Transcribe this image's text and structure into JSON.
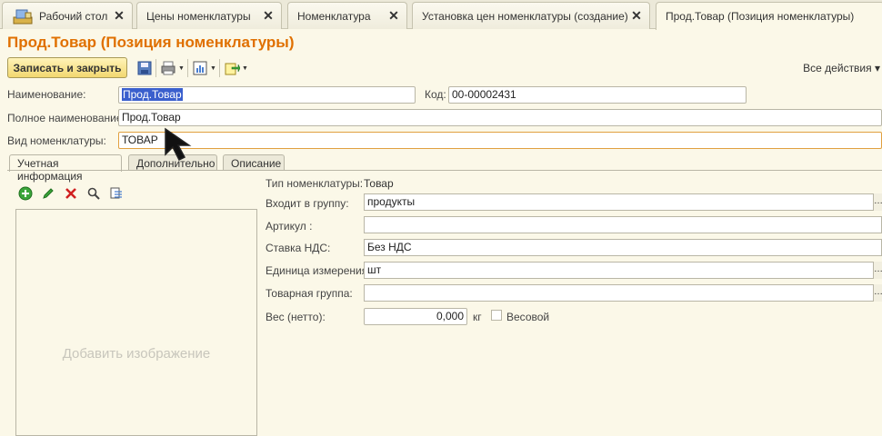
{
  "tabs": [
    {
      "label": "Рабочий стол",
      "home": true
    },
    {
      "label": "Цены номенклатуры"
    },
    {
      "label": "Номенклатура"
    },
    {
      "label": "Установка цен номенклатуры (создание) *"
    },
    {
      "label": "Прод.Товар (Позиция номенклатуры)",
      "active": true
    }
  ],
  "page_title": "Прод.Товар (Позиция номенклатуры)",
  "toolbar": {
    "save_close_label": "Записать и закрыть",
    "all_actions_label": "Все действия ▾"
  },
  "header": {
    "name_label": "Наименование:",
    "name_value": "Прод.Товар",
    "code_label": "Код:",
    "code_value": "00-00002431",
    "full_name_label": "Полное наименование:",
    "full_name_value": "Прод.Товар",
    "kind_label": "Вид номенклатуры:",
    "kind_value": "ТОВАР"
  },
  "inner_tabs": [
    "Учетная информация",
    "Дополнительно",
    "Описание"
  ],
  "image_panel": {
    "placeholder": "Добавить изображение",
    "icons": [
      "add-icon",
      "edit-icon",
      "delete-icon",
      "zoom-icon",
      "select-image-icon"
    ]
  },
  "form": {
    "type_label": "Тип номенклатуры:",
    "type_value": "Товар",
    "group_label": "Входит в группу:",
    "group_value": "продукты",
    "article_label": "Артикул :",
    "article_value": "",
    "vat_label": "Ставка НДС:",
    "vat_value": "Без НДС",
    "unit_label": "Единица измерения:",
    "unit_value": "шт",
    "product_group_label": "Товарная группа:",
    "product_group_value": "",
    "weight_label": "Вес (нетто):",
    "weight_value": "0,000",
    "weight_unit": "кг",
    "by_weight_label": "Весовой"
  },
  "colors": {
    "title": "#e07000",
    "background": "#fbf8e8",
    "selection": "#3a5fcd"
  }
}
